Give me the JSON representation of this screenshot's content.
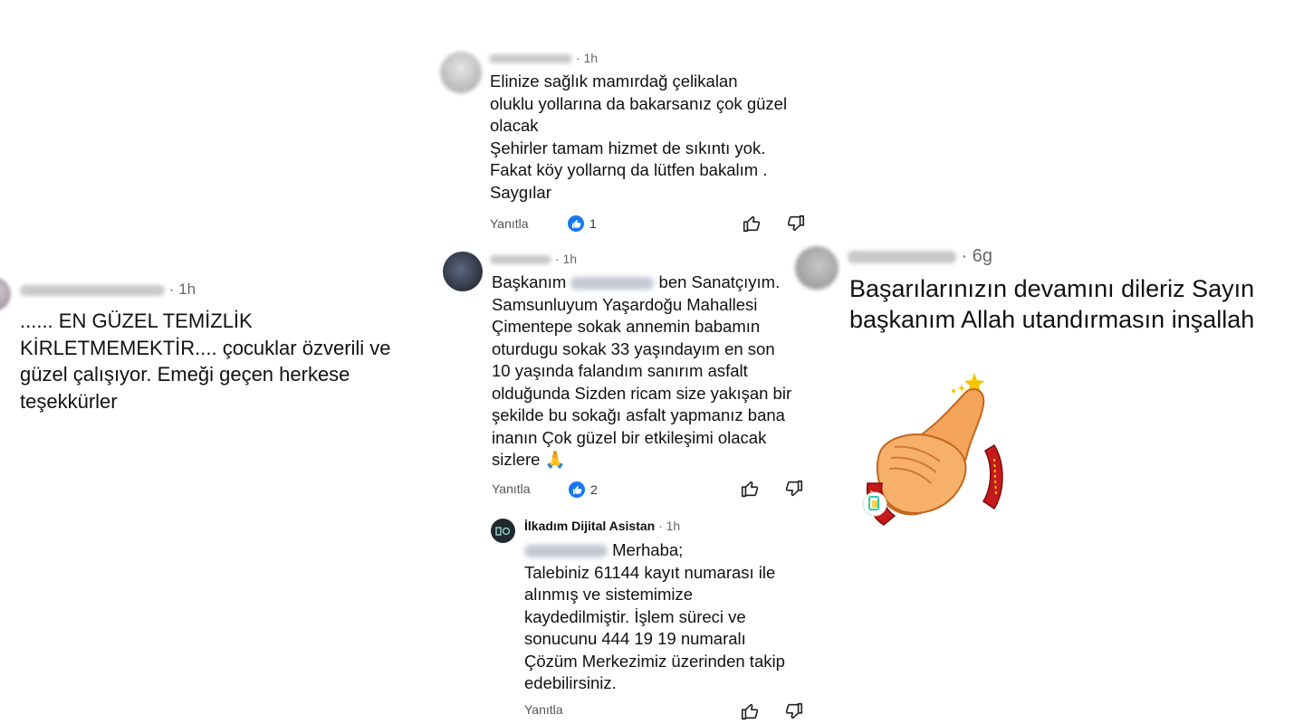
{
  "left_comment": {
    "time": "· 1h",
    "text": "...... EN GÜZEL TEMİZLİK\nKİRLETMEMEKTİR.... çocuklar özverili ve\ngüzel çalışıyor. Emeği geçen herkese\nteşekkürler"
  },
  "comment1": {
    "time": "· 1h",
    "text": "Elinize sağlık  mamırdağ çelikalan\noluklu yollarına da bakarsanız çok güzel\nolacak\n Şehirler tamam hizmet de sıkıntı yok.\nFakat köy yollarnq da lütfen bakalım .\nSaygılar",
    "reply_label": "Yanıtla",
    "like_count": "1"
  },
  "comment2": {
    "time": "· 1h",
    "text_before_name": "Başkanım",
    "text_after_name": " ben Sanatçıyım.\nSamsunluyum Yaşardoğu Mahallesi\nÇimentepe sokak annemin babamın\noturdugu sokak 33 yaşındayım en son\n10 yaşında falandım sanırım asfalt\nolduğunda Sizden ricam size yakışan bir\nşekilde bu sokağı asfalt yapmanız bana\ninanın Çok güzel bir etkileşimi olacak\nsizlere 🙏",
    "reply_label": "Yanıtla",
    "like_count": "2"
  },
  "reply_comment": {
    "author": "İlkadım Dijital Asistan",
    "time": "· 1h",
    "greeting": "Merhaba;",
    "text": "Talebiniz 61144 kayıt numarası ile\nalınmış ve sistemimize\nkaydedilmiştir. İşlem süreci ve\nsonucunu  444 19 19 numaralı\nÇözüm Merkezimiz üzerinden takip\nedebilirsiniz.",
    "reply_label": "Yanıtla"
  },
  "right_comment": {
    "time": "· 6g",
    "text": "Başarılarınızın devamını dileriz Sayın\nbaşkanım Allah utandırmasın inşallah",
    "sticker": "clapping-hands-sticker"
  },
  "colors": {
    "like_blue": "#1877f2",
    "meta_gray": "#666666"
  }
}
